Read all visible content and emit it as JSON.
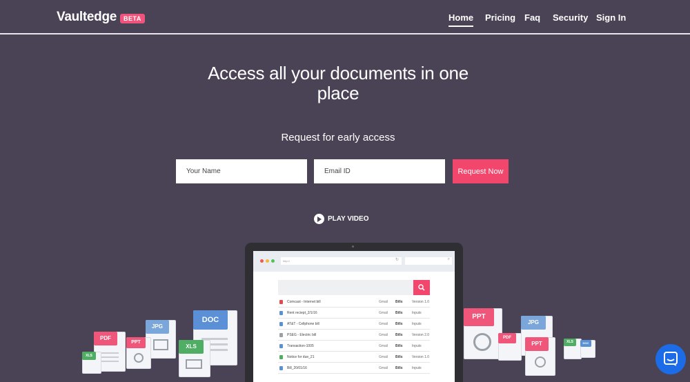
{
  "nav": {
    "brand": "Vaultedge",
    "badge": "BETA",
    "items": [
      {
        "label": "Home"
      },
      {
        "label": "Pricing"
      },
      {
        "label": "Faq"
      },
      {
        "label": "Security"
      },
      {
        "label": "Sign In"
      }
    ],
    "active": "Home"
  },
  "hero": {
    "title": "Access all your documents in one place",
    "subtitle": "Request for early access"
  },
  "form": {
    "name_placeholder": "Your Name",
    "email_placeholder": "Email ID",
    "submit_label": "Request Now"
  },
  "video": {
    "label": "PLAY VIDEO"
  },
  "browser": {
    "url": "http://"
  },
  "document_list": [
    {
      "name": "Comcast - Internet bill",
      "source": "Gmail",
      "category": "Bills",
      "tag": "Version 1.0",
      "icon_color": "#e8474f"
    },
    {
      "name": "Rent reciept_2/1/16",
      "source": "Gmail",
      "category": "Bills",
      "tag": "Inputs",
      "icon_color": "#5b8fd6"
    },
    {
      "name": "AT&T - Cellphone bill",
      "source": "Gmail",
      "category": "Bills",
      "tag": "Inputs",
      "icon_color": "#5b8fd6"
    },
    {
      "name": "PSEG - Electric bill",
      "source": "Gmail",
      "category": "Bills",
      "tag": "Version 2.0",
      "icon_color": "#9aa0a8"
    },
    {
      "name": "Transaction-1005",
      "source": "Gmail",
      "category": "Bills",
      "tag": "Inputs",
      "icon_color": "#5b8fd6"
    },
    {
      "name": "Notice for due_21",
      "source": "Gmail",
      "category": "Bills",
      "tag": "Version 1.0",
      "icon_color": "#4fae63"
    },
    {
      "name": "Bill_20/01/16",
      "source": "Gmail",
      "category": "Bills",
      "tag": "Inputs",
      "icon_color": "#5b8fd6"
    }
  ],
  "file_types": {
    "pdf": "PDF",
    "ppt": "PPT",
    "jpg": "JPG",
    "doc": "DOC",
    "xls": "XLS"
  },
  "colors": {
    "background": "#4a4356",
    "accent": "#f2466c",
    "chat": "#1c6ce8"
  },
  "icons": {
    "play": "play-circle-icon",
    "search": "search-icon",
    "chat": "chat-bubble-icon"
  }
}
